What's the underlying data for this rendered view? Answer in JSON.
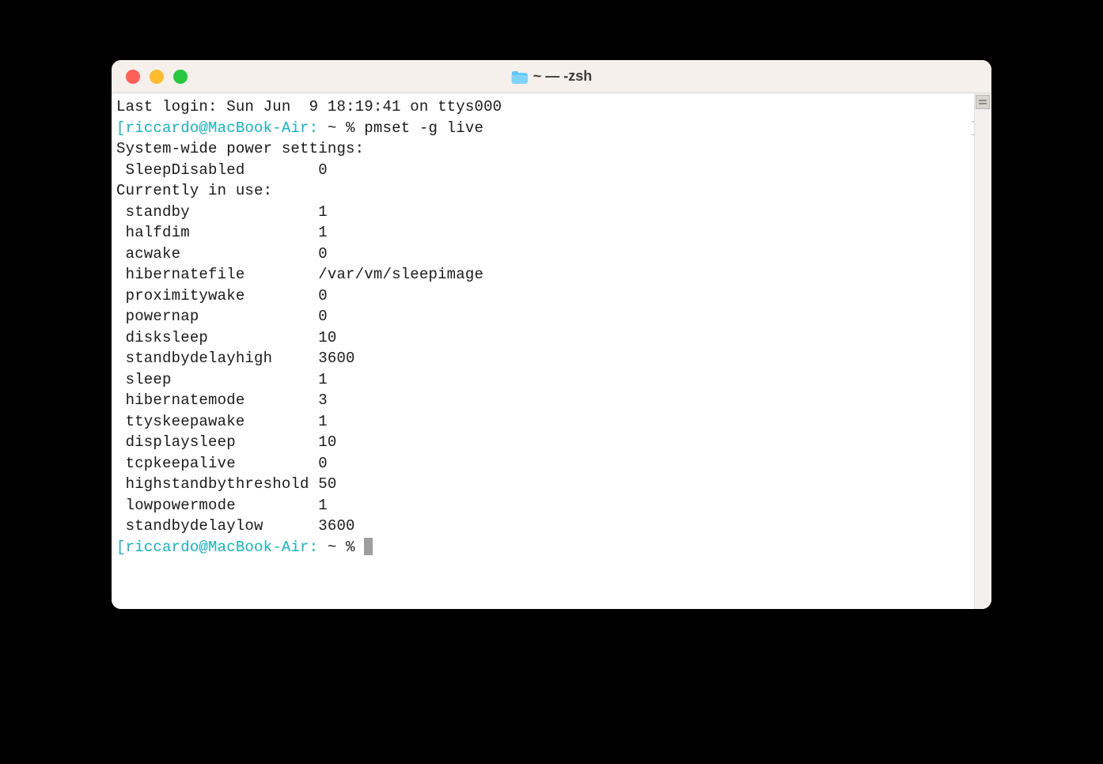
{
  "window": {
    "title": "~ — -zsh"
  },
  "last_login": "Last login: Sun Jun  9 18:19:41 on ttys000",
  "prompt": {
    "open_bracket": "[",
    "user_host": "riccardo@MacBook-Air:",
    "path_and_symbol": " ~ % ",
    "close_bracket": "]"
  },
  "command": "pmset -g live",
  "output": {
    "header1": "System-wide power settings:",
    "sleep_disabled": {
      "key": " SleepDisabled",
      "value": "0"
    },
    "header2": "Currently in use:",
    "rows": [
      {
        "key": " standby",
        "value": "1"
      },
      {
        "key": " halfdim",
        "value": "1"
      },
      {
        "key": " acwake",
        "value": "0"
      },
      {
        "key": " hibernatefile",
        "value": "/var/vm/sleepimage"
      },
      {
        "key": " proximitywake",
        "value": "0"
      },
      {
        "key": " powernap",
        "value": "0"
      },
      {
        "key": " disksleep",
        "value": "10"
      },
      {
        "key": " standbydelayhigh",
        "value": "3600"
      },
      {
        "key": " sleep",
        "value": "1"
      },
      {
        "key": " hibernatemode",
        "value": "3"
      },
      {
        "key": " ttyskeepawake",
        "value": "1"
      },
      {
        "key": " displaysleep",
        "value": "10"
      },
      {
        "key": " tcpkeepalive",
        "value": "0"
      },
      {
        "key": " highstandbythreshold",
        "value": "50"
      },
      {
        "key": " lowpowermode",
        "value": "1"
      },
      {
        "key": " standbydelaylow",
        "value": "3600"
      }
    ]
  }
}
